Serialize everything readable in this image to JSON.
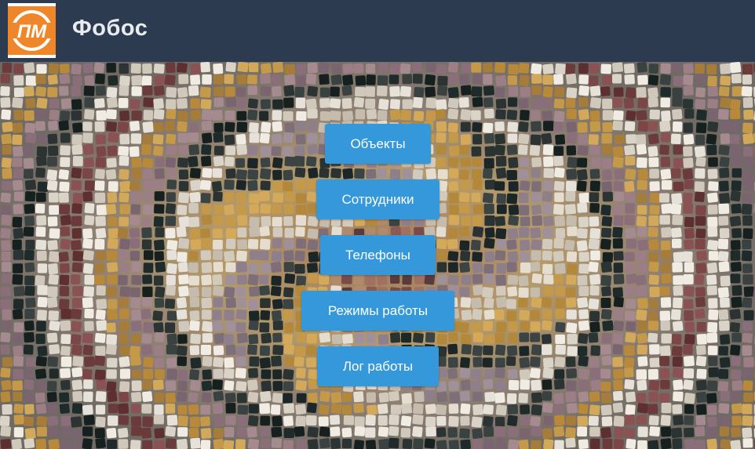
{
  "app": {
    "title": "Фобос",
    "logo_text": "ПМ"
  },
  "colors": {
    "header_bg": "#2d3b50",
    "button_bg": "#3498db",
    "logo_orange": "#f0862a"
  },
  "menu": {
    "items": [
      {
        "id": "objects",
        "label": "Объекты"
      },
      {
        "id": "employees",
        "label": "Сотрудники"
      },
      {
        "id": "phones",
        "label": "Телефоны"
      },
      {
        "id": "work-modes",
        "label": "Режимы работы"
      },
      {
        "id": "work-log",
        "label": "Лог работы"
      }
    ]
  },
  "background": {
    "icon": "mosaic-background-image"
  }
}
